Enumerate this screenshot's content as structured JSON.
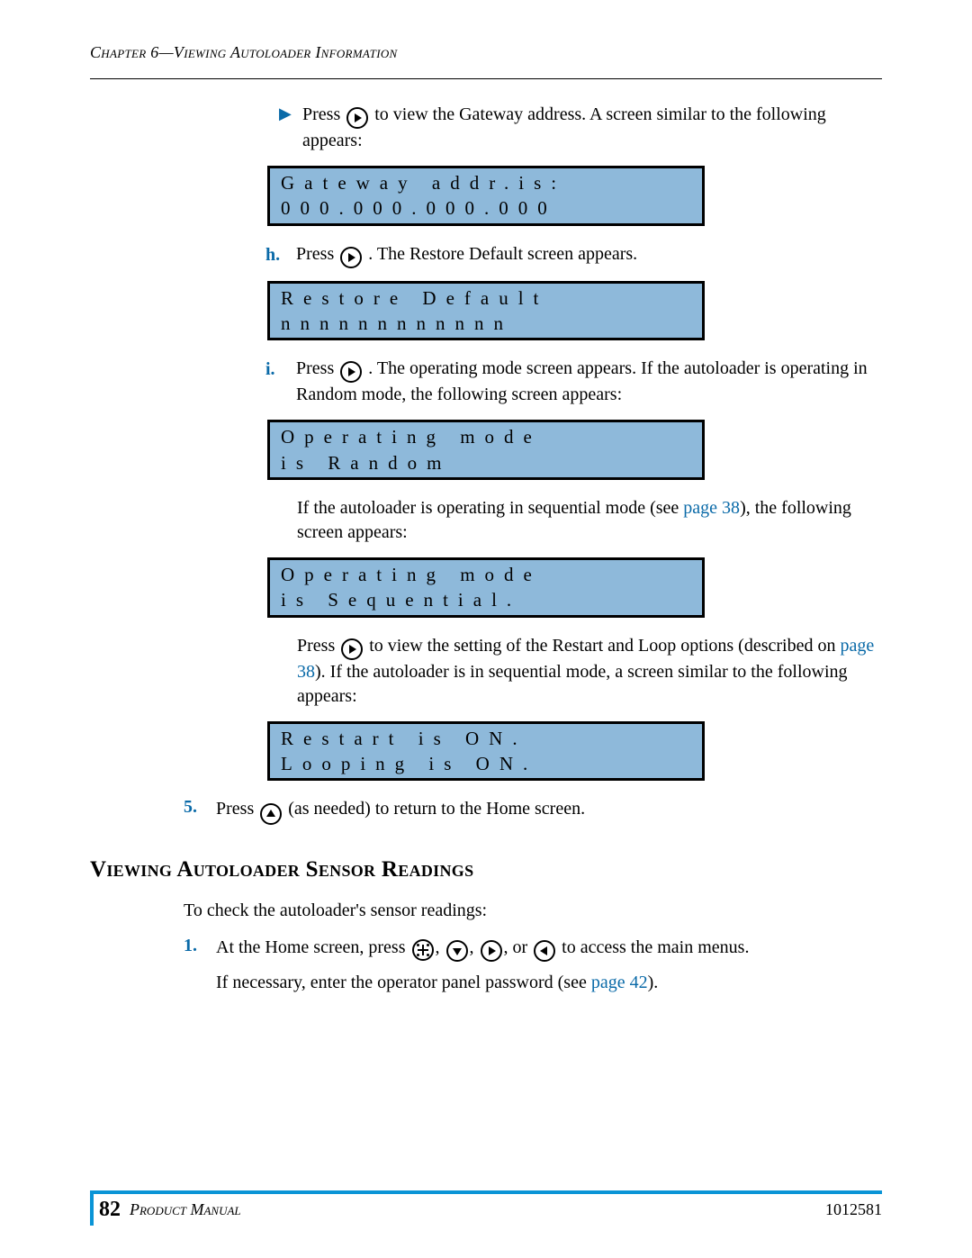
{
  "header": {
    "chapter": "Chapter 6—Viewing Autoloader Information"
  },
  "blocks": {
    "b1_a": "Press ",
    "b1_b": " to view the Gateway address. A screen similar to the following appears:",
    "lcd1_l1": "Gateway addr.is:",
    "lcd1_l2": "000.000.000.000",
    "h_label": "h.",
    "h_a": "Press ",
    "h_b": ". The Restore Default screen appears.",
    "lcd2_l1": "Restore Default",
    "lcd2_l2": "nnnnnnnnnnnn",
    "i_label": "i.",
    "i_a": "Press ",
    "i_b": ". The operating mode screen appears. If the autoloader is operating in Random mode, the following screen appears:",
    "lcd3_l1": "Operating mode",
    "lcd3_l2": "is Random",
    "p_seq_a": "If the autoloader is operating in sequential mode (see ",
    "p_seq_link": "page 38",
    "p_seq_b": "), the following screen appears:",
    "lcd4_l1": "Operating mode",
    "lcd4_l2": "is Sequential.",
    "p_rl_a": "Press ",
    "p_rl_b": " to view the setting of the Restart and Loop options (described on ",
    "p_rl_link": "page 38",
    "p_rl_c": "). If the autoloader is in sequential mode, a screen similar to the following appears:",
    "lcd5_l1": "Restart is ON.",
    "lcd5_l2": "Looping is ON.",
    "n5_label": "5.",
    "n5_a": "Press ",
    "n5_b": " (as needed) to return to the Home screen.",
    "section": "Viewing Autoloader Sensor Readings",
    "s_intro": "To check the autoloader's sensor readings:",
    "n1_label": "1.",
    "n1_a": "At the Home screen, press ",
    "comma": ", ",
    "or": ", or ",
    "n1_b": " to access the main menus.",
    "pw_a": "If necessary, enter the operator panel password (see ",
    "pw_link": "page 42",
    "pw_b": ")."
  },
  "footer": {
    "page": "82",
    "title": "Product Manual",
    "code": "1012581"
  }
}
